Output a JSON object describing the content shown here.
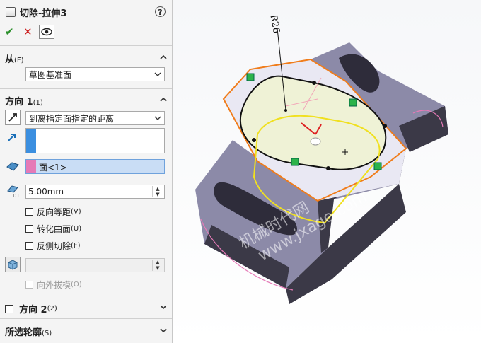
{
  "panel": {
    "title": "切除-拉伸3",
    "help_symbol": "?",
    "ok_symbol": "✔",
    "cancel_symbol": "✕",
    "from": {
      "label": "从",
      "shortcut": "(F)",
      "value": "草图基准面"
    },
    "direction1": {
      "label": "方向 1",
      "shortcut": "(1)",
      "end_condition": "到离指定面指定的距离",
      "face_value": "面<1>",
      "offset_value": "5.00mm",
      "options": [
        {
          "label": "反向等距",
          "shortcut": "(V)"
        },
        {
          "label": "转化曲面",
          "shortcut": "(U)"
        },
        {
          "label": "反侧切除",
          "shortcut": "(F)"
        }
      ],
      "draft_label": "向外拔模",
      "draft_shortcut": "(O)"
    },
    "direction2": {
      "label": "方向 2",
      "shortcut": "(2)"
    },
    "selected_contours": {
      "label": "所选轮廓",
      "shortcut": "(S)"
    }
  },
  "viewport": {
    "dimension_label": "R26",
    "watermark_line1": "机械时代网",
    "watermark_line2": "www.jxage.com"
  },
  "colors": {
    "accent_blue": "#3b8fe0",
    "face_pink": "#e57ab7",
    "sketch_orange": "#f07c1a",
    "preview_yellow": "#f0e020",
    "part_gray": "#9a98b4"
  },
  "icons": [
    "help-icon",
    "eye-icon",
    "flip-direction-icon",
    "direction-vector-icon",
    "face-select-icon",
    "offset-distance-icon",
    "draft-icon",
    "chevron-up-icon",
    "chevron-down-icon"
  ]
}
